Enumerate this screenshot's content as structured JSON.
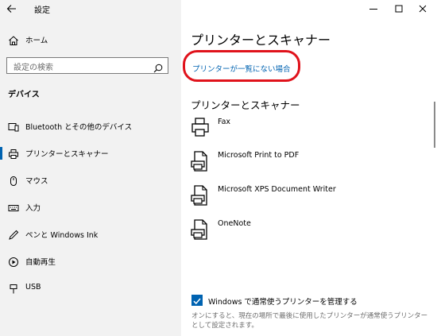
{
  "window": {
    "app_title": "設定",
    "back_icon": "back-arrow-icon",
    "minimize_icon": "minimize-icon",
    "maximize_icon": "maximize-icon",
    "close_icon": "close-icon"
  },
  "sidebar": {
    "home_label": "ホーム",
    "search_placeholder": "設定の検索",
    "section_title": "デバイス",
    "items": [
      {
        "label": "Bluetooth とその他のデバイス",
        "icon": "bluetooth-devices-icon",
        "active": false
      },
      {
        "label": "プリンターとスキャナー",
        "icon": "printer-icon",
        "active": true
      },
      {
        "label": "マウス",
        "icon": "mouse-icon",
        "active": false
      },
      {
        "label": "入力",
        "icon": "keyboard-icon",
        "active": false
      },
      {
        "label": "ペンと Windows Ink",
        "icon": "pen-icon",
        "active": false
      },
      {
        "label": "自動再生",
        "icon": "autoplay-icon",
        "active": false
      },
      {
        "label": "USB",
        "icon": "usb-icon",
        "active": false
      }
    ]
  },
  "main": {
    "title": "プリンターとスキャナー",
    "missing_link": "プリンターが一覧にない場合",
    "sub_heading": "プリンターとスキャナー",
    "printers": [
      {
        "name": "Fax",
        "icon": "fax-icon"
      },
      {
        "name": "Microsoft Print to PDF",
        "icon": "printer-doc-icon"
      },
      {
        "name": "Microsoft XPS Document Writer",
        "icon": "printer-doc-icon"
      },
      {
        "name": "OneNote",
        "icon": "printer-doc-icon"
      }
    ],
    "manage_default": {
      "label": "Windows で通常使うプリンターを管理する",
      "checked": true,
      "description": "オンにすると、現在の場所で最後に使用したプリンターが通常使うプリンターとして設定されます。"
    }
  },
  "colors": {
    "accent": "#0063b1",
    "highlight": "#e0121b",
    "sidebar_bg": "#f2f2f2"
  }
}
